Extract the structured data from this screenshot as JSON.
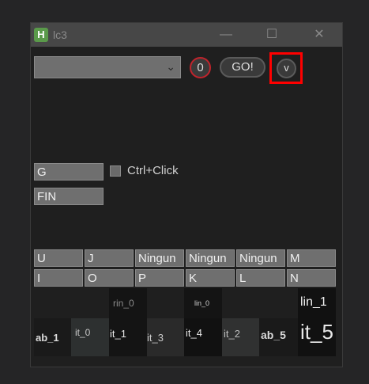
{
  "window": {
    "title": "lc3",
    "icon_letter": "H",
    "minimize": "—",
    "maximize": "☐",
    "close": "✕"
  },
  "toolbar": {
    "dropdown_value": "",
    "counter": "0",
    "go_label": "GO!",
    "v_label": "v"
  },
  "fields": {
    "field1": "G",
    "field2": "FIN"
  },
  "checkbox": {
    "label": "Ctrl+Click",
    "checked": false
  },
  "grid": {
    "row1": [
      "U",
      "J",
      "Ningun",
      "Ningun",
      "Ningun",
      "M"
    ],
    "row2": [
      "I",
      "O",
      "P",
      "K",
      "L",
      "N"
    ]
  },
  "tiles": [
    "ab_1",
    "it_0",
    "it_1",
    "it_3",
    "it_4",
    "it_2",
    "ab_5",
    "it_5",
    "rin_0",
    "lin_0",
    "lin_1"
  ]
}
